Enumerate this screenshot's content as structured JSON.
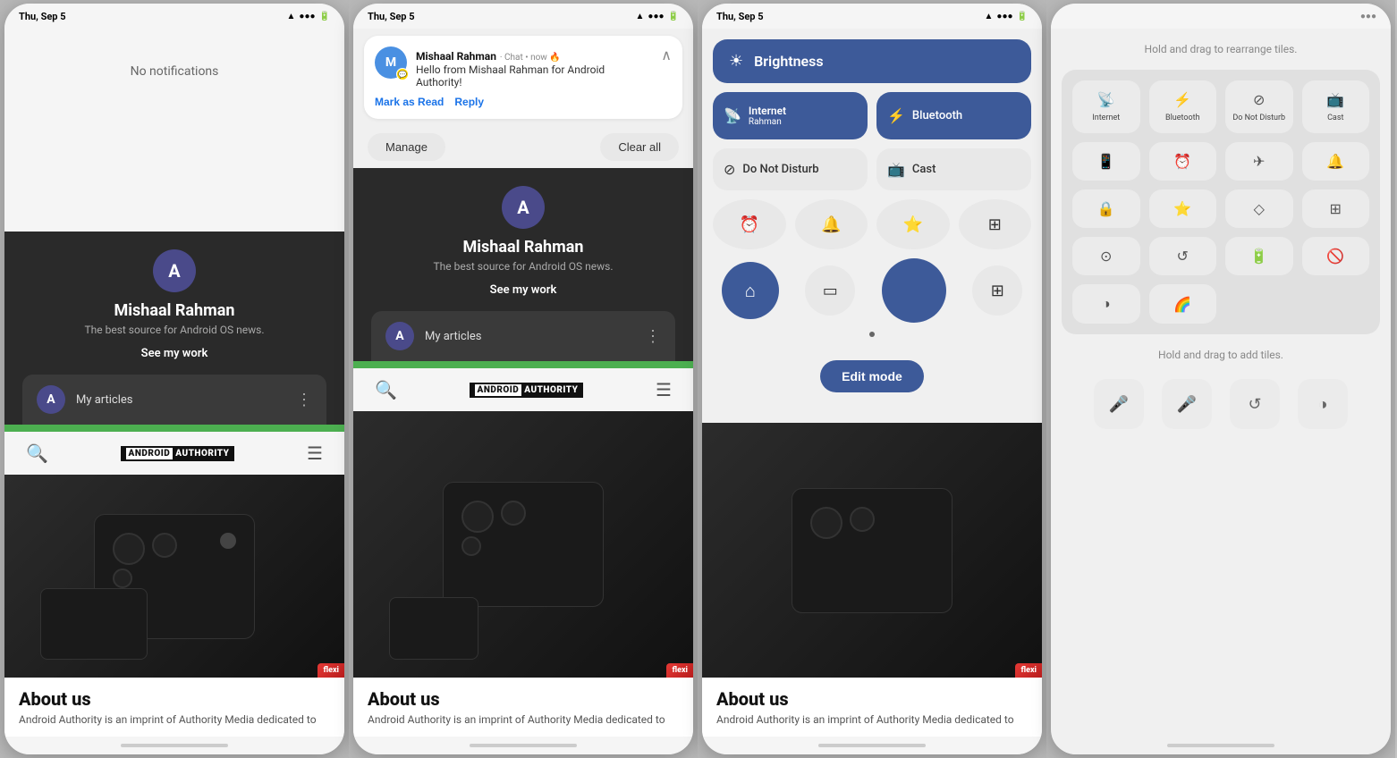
{
  "panels": [
    {
      "id": "panel1",
      "statusBar": {
        "time": "Thu, Sep 5",
        "icons": "📶🔋"
      },
      "noNotifications": "No notifications",
      "profile": {
        "name": "Mishaal Rahman",
        "subtitle": "The best source for Android OS news.",
        "seeWork": "See my work",
        "articlesLabel": "My articles"
      },
      "bottomNav": {
        "searchIcon": "🔍",
        "logo": "ANDROID AUTHORITY",
        "menuIcon": "☰"
      },
      "articleSection": {
        "title": "About us",
        "body": "Android Authority is an imprint of Authority Media dedicated to"
      }
    },
    {
      "id": "panel2",
      "statusBar": {
        "time": "Thu, Sep 5",
        "icons": "📶🔋"
      },
      "notification": {
        "sender": "Mishaal Rahman",
        "appLabel": "Chat • now 🔥",
        "body": "Hello from Mishaal Rahman for Android Authority!",
        "markAsRead": "Mark as Read",
        "reply": "Reply"
      },
      "manageBtn": "Manage",
      "clearAllBtn": "Clear all",
      "profile": {
        "name": "Mishaal Rahman",
        "subtitle": "The best source for Android OS news.",
        "seeWork": "See my work",
        "articlesLabel": "My articles"
      },
      "bottomNav": {
        "searchIcon": "🔍",
        "logo": "ANDROID AUTHORITY",
        "menuIcon": "☰"
      },
      "articleSection": {
        "title": "About us",
        "body": "Android Authority is an imprint of Authority Media dedicated to"
      }
    },
    {
      "id": "panel3",
      "statusBar": {
        "time": "Thu, Sep 5",
        "icons": "📶🔋"
      },
      "quickSettings": {
        "brightnessLabel": "Brightness",
        "internetLabel": "Internet\nRahman",
        "bluetoothLabel": "Bluetooth",
        "doNotDisturbLabel": "Do Not Disturb",
        "castLabel": "Cast",
        "editModeBtn": "Edit mode"
      },
      "articleSection": {
        "title": "About us",
        "body": "Android Authority is an imprint of Authority Media dedicated to"
      }
    },
    {
      "id": "panel4",
      "statusBar": {
        "time": "",
        "icons": ""
      },
      "editMode": {
        "hintTop": "Hold and drag to rearrange tiles.",
        "tiles": [
          {
            "icon": "📡",
            "label": "Internet"
          },
          {
            "icon": "⚡",
            "label": "Bluetooth"
          },
          {
            "icon": "⊘",
            "label": "Do Not Disturb"
          },
          {
            "icon": "📺",
            "label": "Cast"
          },
          {
            "icon": "📱",
            "label": ""
          },
          {
            "icon": "⏰",
            "label": ""
          },
          {
            "icon": "✈",
            "label": ""
          },
          {
            "icon": "🔔",
            "label": ""
          },
          {
            "icon": "🔒",
            "label": ""
          },
          {
            "icon": "⭐",
            "label": ""
          },
          {
            "icon": "◇",
            "label": ""
          },
          {
            "icon": "⊞",
            "label": ""
          },
          {
            "icon": "⊙",
            "label": ""
          },
          {
            "icon": "↺",
            "label": ""
          },
          {
            "icon": "🔋",
            "label": ""
          },
          {
            "icon": "🚫",
            "label": ""
          },
          {
            "icon": "◑",
            "label": ""
          },
          {
            "icon": "🌈",
            "label": ""
          }
        ],
        "hintBottom": "Hold and drag to add tiles.",
        "addTiles": [
          {
            "icon": "🎤"
          },
          {
            "icon": "🎤"
          },
          {
            "icon": "↺"
          },
          {
            "icon": "◑"
          }
        ]
      }
    }
  ]
}
